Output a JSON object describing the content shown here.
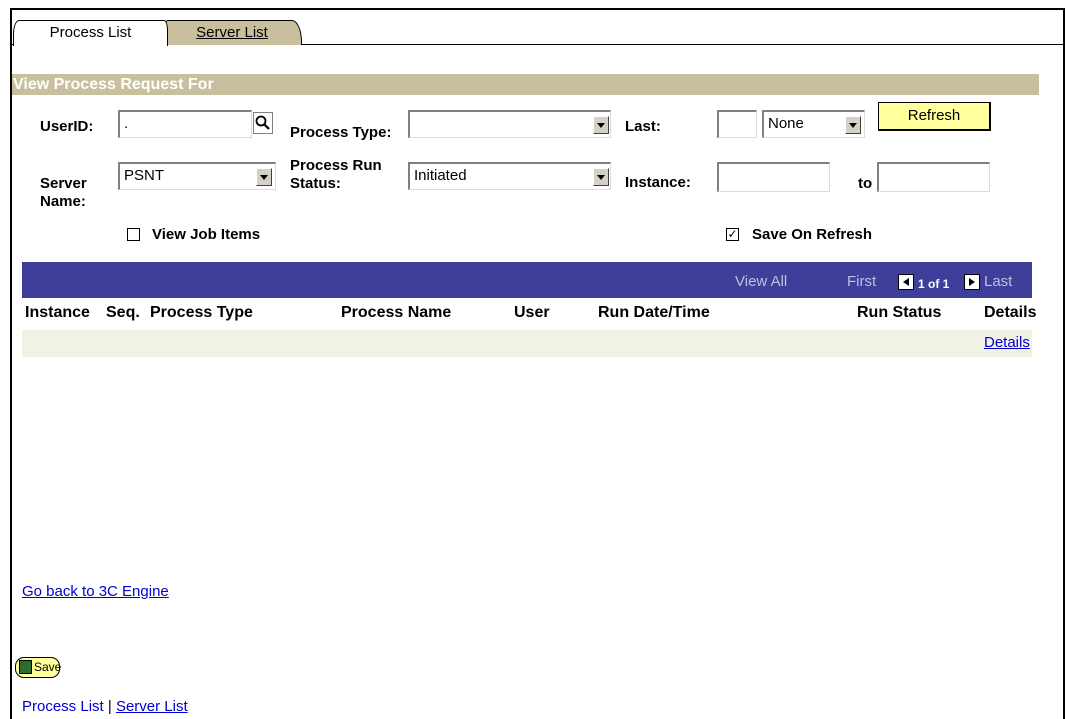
{
  "tabs": [
    {
      "label": "Process List",
      "active": true
    },
    {
      "label": "Server List",
      "active": false
    }
  ],
  "section_title": "View Process Request For",
  "filters": {
    "userid_label": "UserID:",
    "userid_value": ".",
    "process_type_label": "Process Type:",
    "process_type_value": "",
    "last_label": "Last:",
    "last_value": "",
    "last_unit_value": "None",
    "refresh_label": "Refresh",
    "server_name_label": "Server Name:",
    "server_name_value": "PSNT",
    "run_status_label": "Process Run Status:",
    "run_status_value": "Initiated",
    "instance_label": "Instance:",
    "instance_from": "",
    "to_label": "to",
    "instance_to": "",
    "view_job_items_label": "View Job Items",
    "view_job_items_checked": false,
    "save_on_refresh_label": "Save On Refresh",
    "save_on_refresh_checked": true
  },
  "grid": {
    "view_all": "View All",
    "first": "First",
    "page_info": "1 of 1",
    "last": "Last",
    "columns": [
      "Instance",
      "Seq.",
      "Process Type",
      "Process Name",
      "User",
      "Run Date/Time",
      "Run Status",
      "Details"
    ],
    "rows": [
      {
        "details_link": "Details"
      }
    ]
  },
  "links": {
    "go_back": "Go back to 3C Engine",
    "footer_process_list": "Process List",
    "footer_separator": "|",
    "footer_server_list": "Server List"
  },
  "save_button": "Save",
  "colors": {
    "section_bar": "#c8bf9e",
    "grid_bar": "#3f3f9b",
    "refresh_button": "#ffff9c",
    "link": "#0000cc"
  }
}
